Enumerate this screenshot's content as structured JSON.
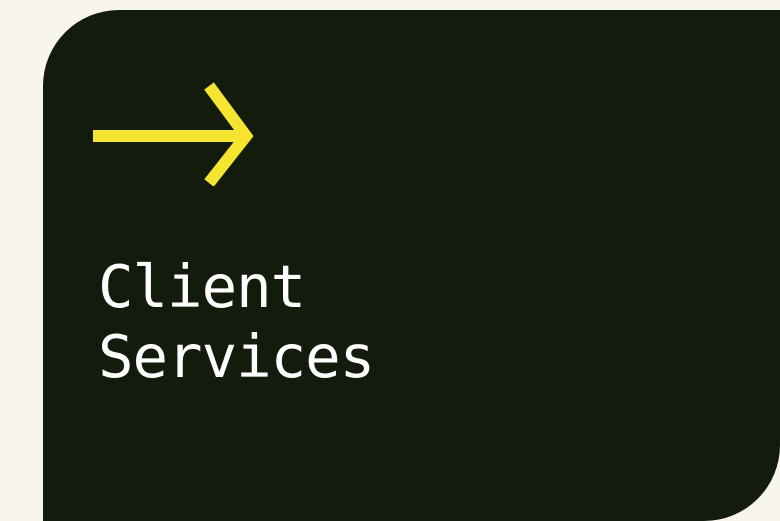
{
  "card": {
    "title_line1": "Client",
    "title_line2": "Services",
    "icon": "arrow-right-icon",
    "accent_color": "#f5e430",
    "background_color": "#131b0c",
    "page_background": "#f8f5ea"
  }
}
